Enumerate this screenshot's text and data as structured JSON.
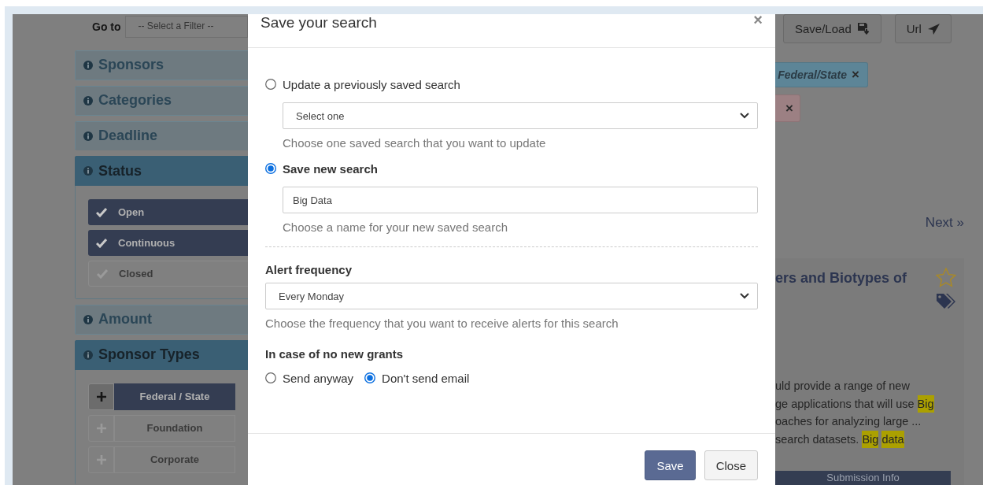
{
  "goto": {
    "label": "Go to",
    "select": "-- Select a Filter --"
  },
  "filters": [
    {
      "title": "Sponsors",
      "expanded": false
    },
    {
      "title": "Categories",
      "expanded": false
    },
    {
      "title": "Deadline",
      "expanded": false
    },
    {
      "title": "Status",
      "expanded": true,
      "kind": "checklist",
      "options": [
        {
          "label": "Open",
          "checked": true
        },
        {
          "label": "Continuous",
          "checked": true
        },
        {
          "label": "Closed",
          "checked": false
        }
      ]
    },
    {
      "title": "Amount",
      "expanded": false
    },
    {
      "title": "Sponsor Types",
      "expanded": true,
      "kind": "toggles",
      "options": [
        {
          "label": "Federal / State",
          "selected": true
        },
        {
          "label": "Foundation",
          "selected": false
        },
        {
          "label": "Corporate",
          "selected": false
        }
      ]
    }
  ],
  "toolbar": [
    {
      "label": "Save/Load"
    },
    {
      "label": "Url"
    }
  ],
  "active_filters": [
    {
      "label": "Federal/State",
      "remove": "×",
      "color": "#5d8597"
    },
    {
      "remove": "×",
      "color": "#9c8083"
    }
  ],
  "pager": {
    "next": "Next »"
  },
  "result": {
    "title": "ers and Biotypes of",
    "starred": false,
    "snippet": [
      [
        {
          "text": "uld provide a range of new",
          "highlighted": false
        }
      ],
      [
        {
          "text": "ge applications that will use",
          "highlighted": false
        },
        {
          "text": "Big",
          "highlighted": true
        }
      ],
      [
        {
          "text": "oaches for analyzing large ...",
          "highlighted": false
        }
      ],
      [
        {
          "text": "search datasets.",
          "highlighted": false
        },
        {
          "text": "Big",
          "highlighted": true
        },
        {
          "text": "data",
          "highlighted": true
        }
      ]
    ],
    "action": "Submission Info"
  },
  "modal": {
    "title": "Save your search",
    "close": "×",
    "update": {
      "label": "Update a previously saved search",
      "selected": false,
      "select": "Select one",
      "help": "Choose one saved search that you want to update"
    },
    "new": {
      "label": "Save new search",
      "selected": true,
      "value": "Big Data",
      "help": "Choose a name for your new saved search"
    },
    "alert": {
      "label": "Alert frequency",
      "select": "Every Monday",
      "help": "Choose the frequency that you want to receive alerts for this search"
    },
    "no_grants": {
      "label": "In case of no new grants",
      "options": [
        {
          "label": "Send anyway",
          "selected": false
        },
        {
          "label": "Don't send email",
          "selected": true
        }
      ]
    },
    "buttons": [
      {
        "label": "Save",
        "kind": "primary"
      },
      {
        "label": "Close",
        "kind": "default"
      }
    ]
  }
}
